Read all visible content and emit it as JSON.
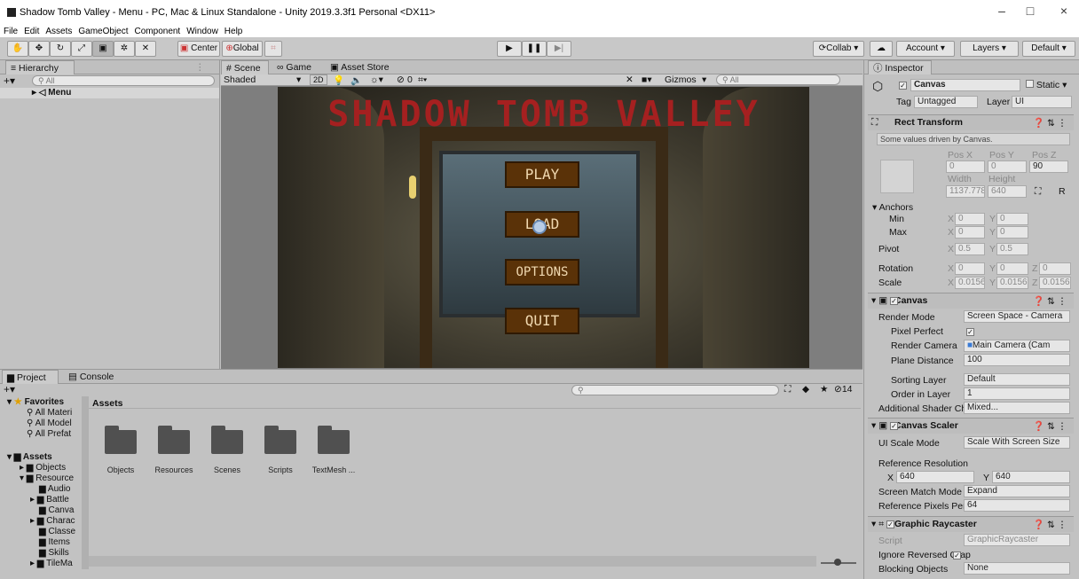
{
  "window": {
    "title": "Shadow Tomb Valley - Menu - PC, Mac & Linux Standalone - Unity 2019.3.3f1 Personal <DX11>",
    "controls": [
      "–",
      "□",
      "×"
    ]
  },
  "menu": [
    "File",
    "Edit",
    "Assets",
    "GameObject",
    "Component",
    "Window",
    "Help"
  ],
  "toolbar": {
    "tools": [
      "hand-icon",
      "move-icon",
      "rotate-icon",
      "scale-icon",
      "rect-icon",
      "transform-icon",
      "custom-tool-icon"
    ],
    "center": "Center",
    "global": "Global",
    "collab": "Collab",
    "account": "Account",
    "layers": "Layers",
    "layout": "Default"
  },
  "hierarchy": {
    "tab": "Hierarchy",
    "search": "All",
    "root": "Menu"
  },
  "scene": {
    "tabs": [
      "Scene",
      "Game",
      "Asset Store"
    ],
    "shading": "Shaded",
    "mode2d": "2D",
    "hidden_count": "0",
    "gizmos": "Gizmos",
    "search": "All"
  },
  "game": {
    "title": "SHADOW TOMB VALLEY",
    "buttons": [
      "PLAY",
      "LOAD",
      "OPTIONS",
      "QUIT"
    ]
  },
  "project": {
    "tabs": [
      "Project",
      "Console"
    ],
    "count": "14",
    "favorites_label": "Favorites",
    "favorites": [
      "All Materi",
      "All Model",
      "All Prefat"
    ],
    "assets_label": "Assets",
    "tree": [
      "Objects",
      "Resource",
      "Audio",
      "Battle",
      "Canva",
      "Charac",
      "Classe",
      "Items",
      "Skills",
      "TileMa"
    ],
    "breadcrumb": "Assets",
    "folders": [
      "Objects",
      "Resources",
      "Scenes",
      "Scripts",
      "TextMesh ..."
    ]
  },
  "inspector": {
    "tab": "Inspector",
    "object_name": "Canvas",
    "static": "Static",
    "tag_label": "Tag",
    "tag": "Untagged",
    "layer_label": "Layer",
    "layer": "UI",
    "rect_transform": {
      "title": "Rect Transform",
      "note": "Some values driven by Canvas.",
      "pos_labels": [
        "Pos X",
        "Pos Y",
        "Pos Z"
      ],
      "pos": [
        "0",
        "0",
        "90"
      ],
      "size_labels": [
        "Width",
        "Height"
      ],
      "width": "1137.778",
      "height": "640",
      "r": "R",
      "anchors": "Anchors",
      "min": "Min",
      "max": "Max",
      "pivot": "Pivot",
      "rotation": "Rotation",
      "scale": "Scale",
      "x": "X",
      "y": "Y",
      "z": "Z",
      "min_x": "0",
      "min_y": "0",
      "max_x": "0",
      "max_y": "0",
      "pivot_x": "0.5",
      "pivot_y": "0.5",
      "rot_x": "0",
      "rot_y": "0",
      "rot_z": "0",
      "scale_x": "0.0156",
      "scale_y": "0.0156",
      "scale_z": "0.0156"
    },
    "canvas": {
      "title": "Canvas",
      "render_mode_label": "Render Mode",
      "render_mode": "Screen Space - Camera",
      "pixel_perfect_label": "Pixel Perfect",
      "render_camera_label": "Render Camera",
      "render_camera": "Main Camera (Cam",
      "plane_distance_label": "Plane Distance",
      "plane_distance": "100",
      "sorting_layer_label": "Sorting Layer",
      "sorting_layer": "Default",
      "order_label": "Order in Layer",
      "order": "1",
      "shader_label": "Additional Shader Ch",
      "shader": "Mixed..."
    },
    "scaler": {
      "title": "Canvas Scaler",
      "ui_scale_label": "UI Scale Mode",
      "ui_scale": "Scale With Screen Size",
      "ref_res_label": "Reference Resolution",
      "ref_x": "640",
      "ref_y": "640",
      "match_label": "Screen Match Mode",
      "match": "Expand",
      "ppu_label": "Reference Pixels Per",
      "ppu": "64"
    },
    "raycaster": {
      "title": "Graphic Raycaster",
      "script_label": "Script",
      "script": "GraphicRaycaster",
      "ignore_label": "Ignore Reversed Grap",
      "blocking_label": "Blocking Objects",
      "blocking": "None"
    }
  }
}
